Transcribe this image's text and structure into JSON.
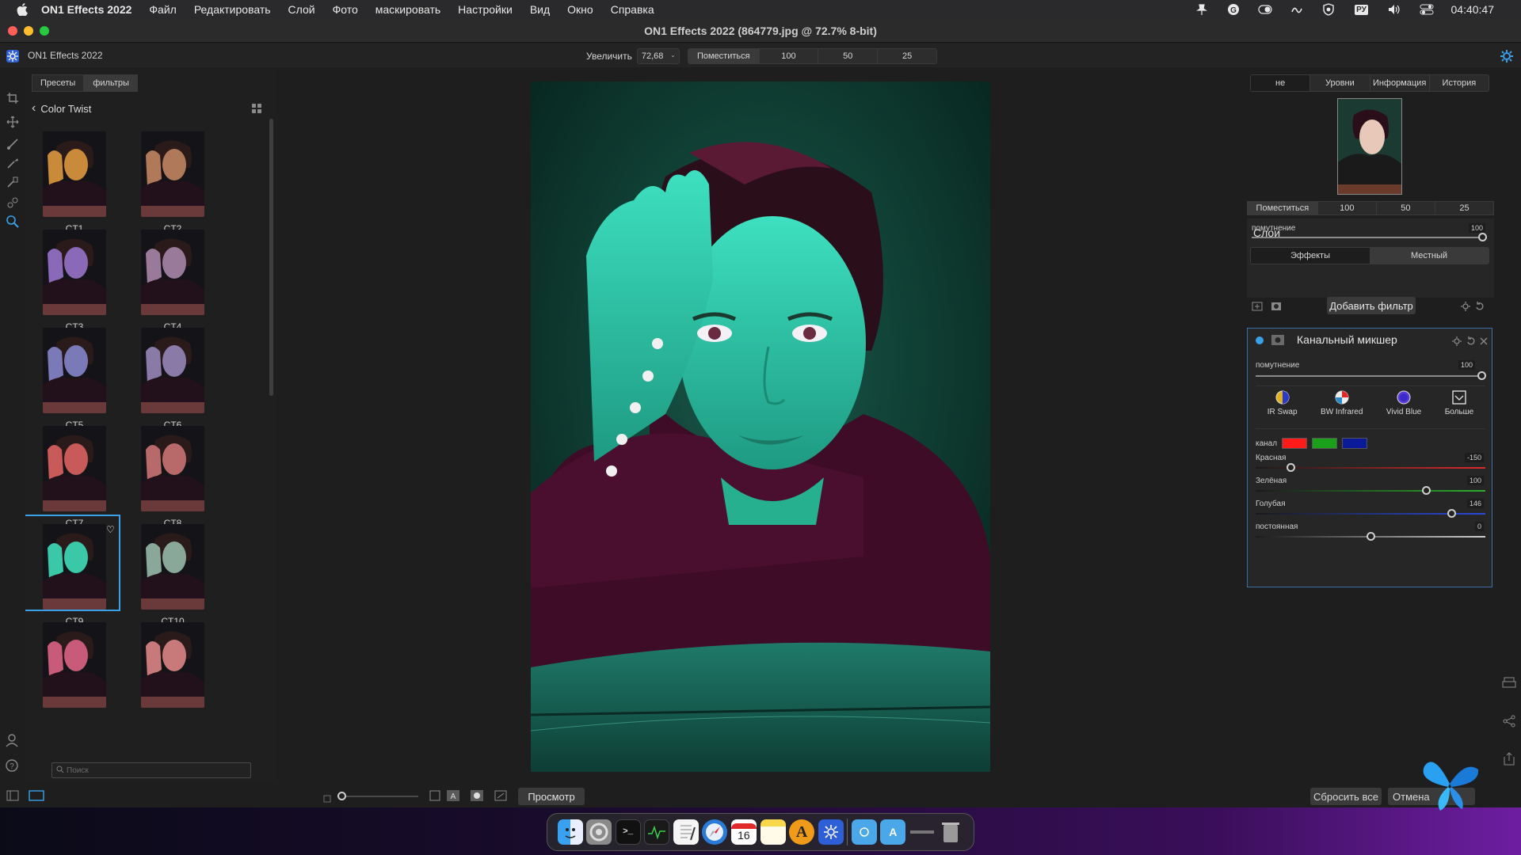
{
  "menubar": {
    "app_name": "ON1 Effects 2022",
    "items": [
      "Файл",
      "Редактировать",
      "Слой",
      "Фото",
      "маскировать",
      "Настройки",
      "Вид",
      "Окно",
      "Справка"
    ],
    "clock": "04:40:47",
    "lang": "РУ"
  },
  "window": {
    "title": "ON1 Effects 2022 (864779.jpg @ 72.7% 8-bit)"
  },
  "appbar": {
    "app_label": "ON1 Effects 2022",
    "zoom_label": "Увеличить",
    "zoom_value": "72,68",
    "fit_options": [
      "Поместиться",
      "100",
      "50",
      "25"
    ]
  },
  "left_panel": {
    "tabs": [
      "Пресеты",
      "фильтры"
    ],
    "active_tab": "фильтры",
    "category": "Color Twist",
    "presets": [
      {
        "label": "CT1",
        "tint": "#c98a3a"
      },
      {
        "label": "CT2",
        "tint": "#b07a5a"
      },
      {
        "label": "CT3",
        "tint": "#8a6ab8"
      },
      {
        "label": "CT4",
        "tint": "#9a7a9a"
      },
      {
        "label": "CT5",
        "tint": "#7a7ab8"
      },
      {
        "label": "CT6",
        "tint": "#8a7aa8"
      },
      {
        "label": "CT7",
        "tint": "#c85a5a"
      },
      {
        "label": "CT8",
        "tint": "#b86a6a"
      },
      {
        "label": "CT9",
        "tint": "#3ac8a8"
      },
      {
        "label": "CT10",
        "tint": "#8aa89a"
      }
    ],
    "selected_preset": "CT9",
    "search_placeholder": "Поиск"
  },
  "right_panel": {
    "tabs": [
      "не",
      "Уровни",
      "Информация",
      "История"
    ],
    "nav_fit": [
      "Поместиться",
      "100",
      "50",
      "25"
    ],
    "layers_title": "Слои",
    "layer_tabs": [
      "Эффекты",
      "Местный"
    ],
    "opacity_label": "помутнение",
    "opacity_value": "100",
    "add_filter": "Добавить фильтр"
  },
  "filter": {
    "title": "Канальный микшер",
    "opacity_label": "помутнение",
    "opacity_value": "100",
    "presets": [
      {
        "label": "IR Swap",
        "icon": "ir-swap-icon"
      },
      {
        "label": "BW Infrared",
        "icon": "bw-infrared-icon"
      },
      {
        "label": "Vivid Blue",
        "icon": "vivid-blue-icon"
      },
      {
        "label": "Больше",
        "icon": "more-presets-icon"
      }
    ],
    "channel_label": "канал",
    "channel_colors": [
      "#ff1a1a",
      "#1aa01a",
      "#0a1a9a"
    ],
    "sliders": [
      {
        "label": "Красная",
        "value": "-150",
        "pos": 0.15
      },
      {
        "label": "Зелёная",
        "value": "100",
        "pos": 0.74
      },
      {
        "label": "Голубая",
        "value": "146",
        "pos": 0.85
      },
      {
        "label": "постоянная",
        "value": "0",
        "pos": 0.5
      }
    ]
  },
  "bottom": {
    "preview": "Просмотр",
    "reset_all": "Сбросить все",
    "cancel": "Отмена"
  },
  "dock": {
    "calendar_day": "16"
  }
}
